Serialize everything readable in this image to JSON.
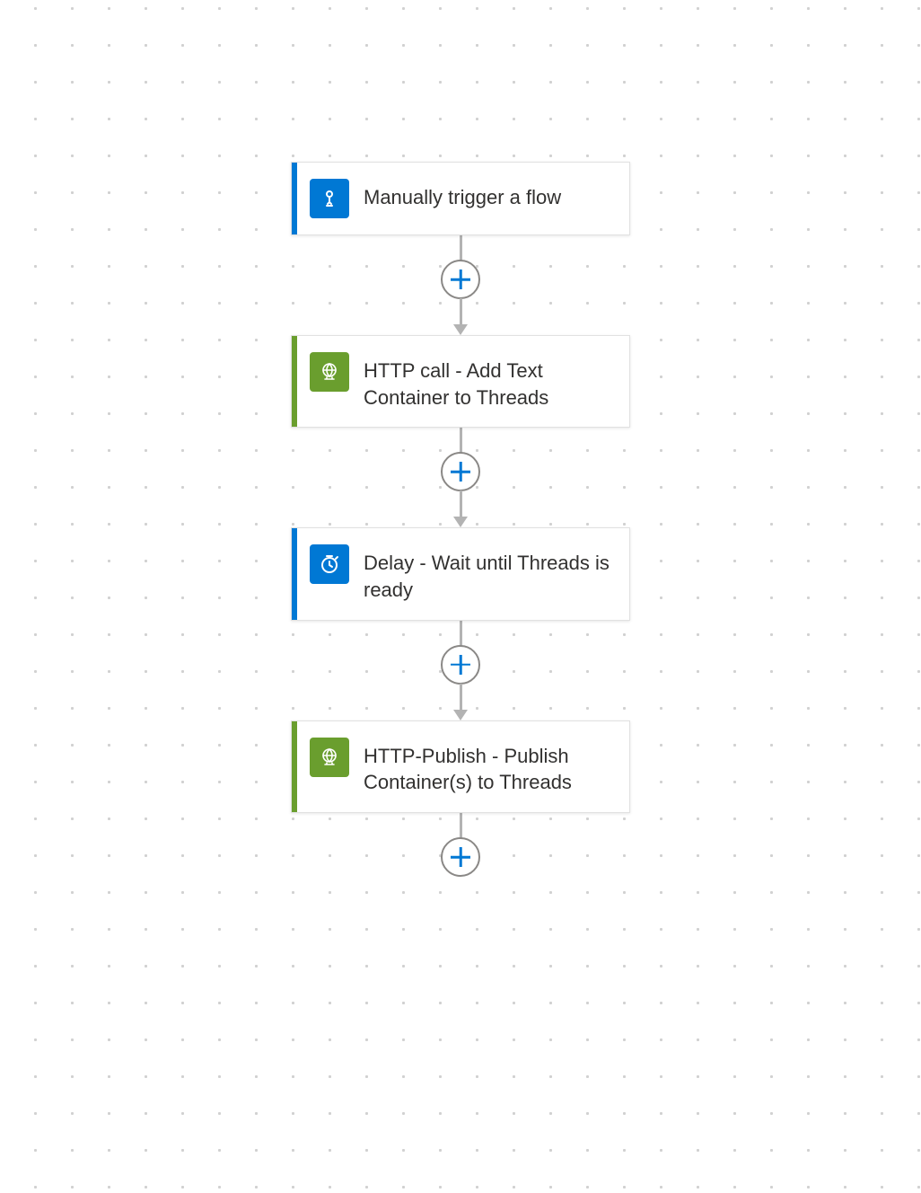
{
  "colors": {
    "blue": "#0078d4",
    "green": "#6a9e2e"
  },
  "nodes": [
    {
      "id": "trigger",
      "label": "Manually trigger a flow",
      "icon": "touch",
      "accent": "#0078d4",
      "iconBg": "#0078d4"
    },
    {
      "id": "http-add",
      "label": "HTTP call - Add Text Container to Threads",
      "icon": "globe",
      "accent": "#6a9e2e",
      "iconBg": "#6a9e2e"
    },
    {
      "id": "delay",
      "label": "Delay - Wait until Threads is ready",
      "icon": "clock",
      "accent": "#0078d4",
      "iconBg": "#0078d4"
    },
    {
      "id": "http-publish",
      "label": "HTTP-Publish - Publish Container(s) to Threads",
      "icon": "globe",
      "accent": "#6a9e2e",
      "iconBg": "#6a9e2e"
    }
  ]
}
